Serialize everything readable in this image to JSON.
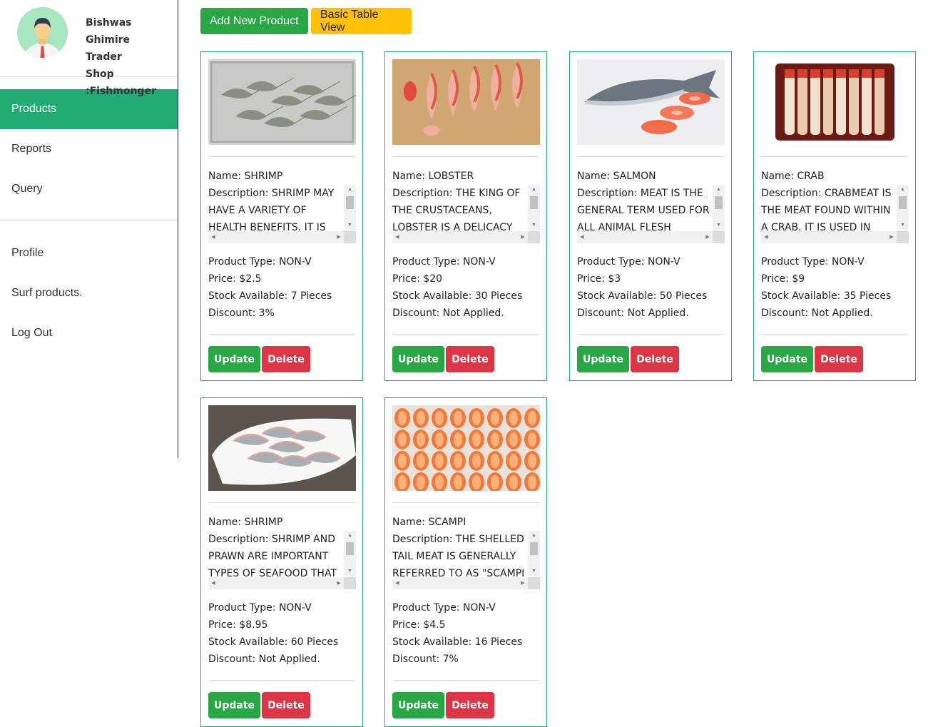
{
  "profile": {
    "name": "Bishwas Ghimire",
    "role": "Trader",
    "shop": "Shop :Fishmonger"
  },
  "nav": {
    "items": [
      "Products",
      "Reports",
      "Query"
    ],
    "bottom": [
      "Profile",
      "Surf products.",
      "Log Out"
    ],
    "active": "Products"
  },
  "toolbar": {
    "add_label": "Add New Product",
    "table_label": "Basic Table View"
  },
  "labels": {
    "name": "Name: ",
    "description": "Description: ",
    "type": "Product Type: ",
    "price": "Price: ",
    "stock": "Stock Available: ",
    "discount": "Discount: ",
    "update": "Update",
    "delete": "Delete"
  },
  "products": [
    {
      "name": "SHRIMP",
      "description": "SHRIMP MAY HAVE A VARIETY OF HEALTH BENEFITS. IT IS",
      "type": "NON-V",
      "price": "$2.5",
      "stock": "7 Pieces",
      "discount": "3%"
    },
    {
      "name": "LOBSTER",
      "description": "THE KING OF THE CRUSTACEANS, LOBSTER IS A DELICACY",
      "type": "NON-V",
      "price": "$20",
      "stock": "30 Pieces",
      "discount": "Not Applied."
    },
    {
      "name": "SALMON",
      "description": "MEAT IS THE GENERAL TERM USED FOR ALL ANIMAL FLESH",
      "type": "NON-V",
      "price": "$3",
      "stock": "50 Pieces",
      "discount": "Not Applied."
    },
    {
      "name": "CRAB",
      "description": "CRABMEAT IS THE MEAT FOUND WITHIN A CRAB. IT IS USED IN MANY",
      "type": "NON-V",
      "price": "$9",
      "stock": "35 Pieces",
      "discount": "Not Applied."
    },
    {
      "name": "SHRIMP",
      "description": "SHRIMP AND PRAWN ARE IMPORTANT TYPES OF SEAFOOD THAT",
      "type": "NON-V",
      "price": "$8.95",
      "stock": "60 Pieces",
      "discount": "Not Applied."
    },
    {
      "name": "SCAMPI",
      "description": "THE SHELLED TAIL MEAT IS GENERALLY REFERRED TO AS \"SCAMPI",
      "type": "NON-V",
      "price": "$4.5",
      "stock": "16 Pieces",
      "discount": "7%"
    }
  ]
}
